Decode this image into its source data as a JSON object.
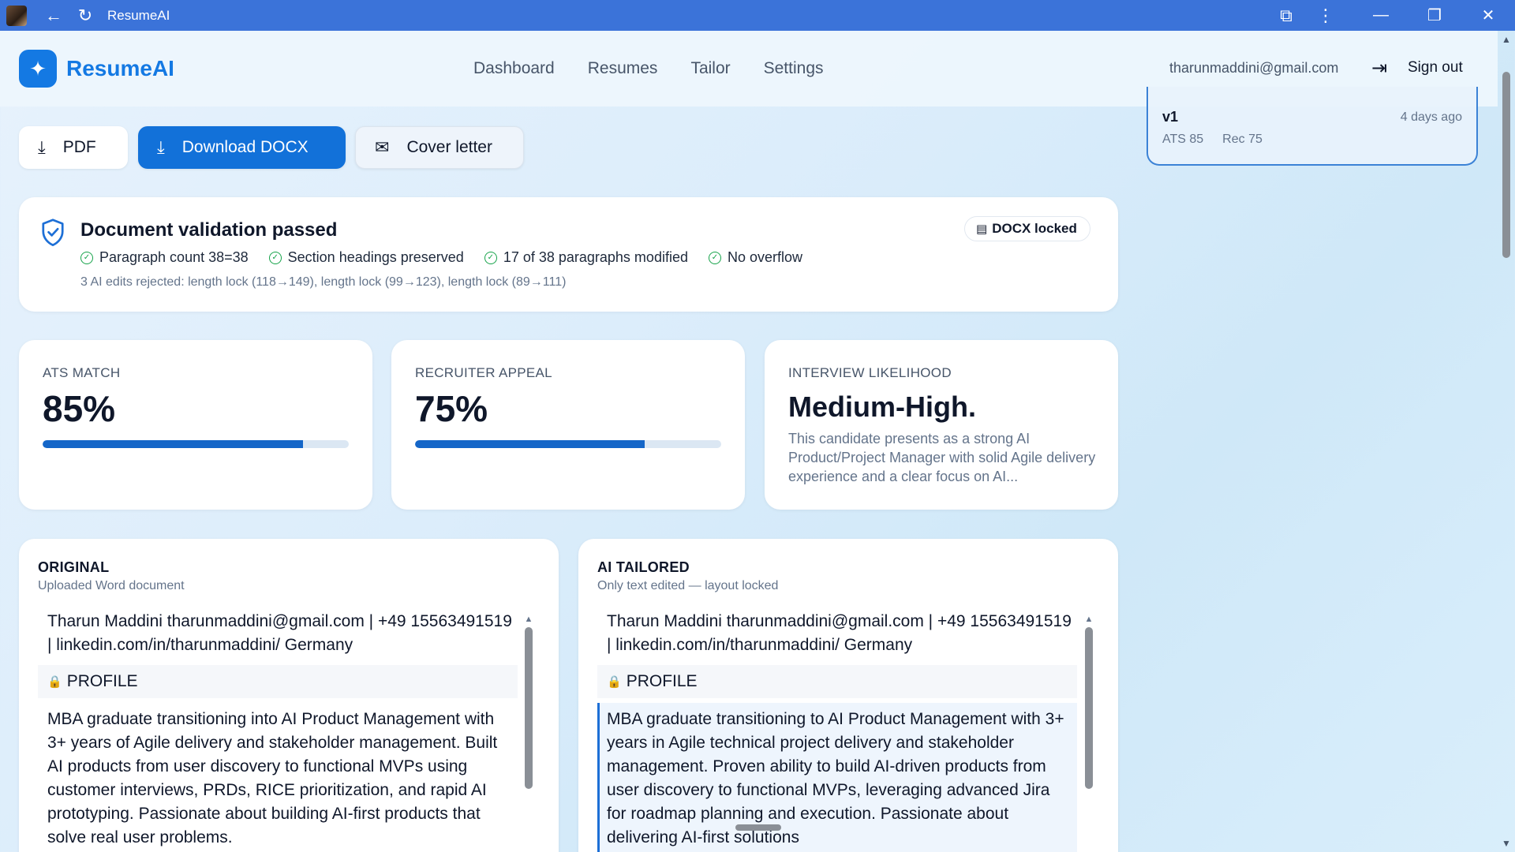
{
  "browser": {
    "tab_title": "ResumeAI",
    "back_icon": "←",
    "reload_icon": "↻",
    "extensions_icon": "⧉",
    "menu_icon": "⋮",
    "minimize_icon": "—",
    "restore_icon": "❐",
    "close_icon": "✕"
  },
  "header": {
    "logo_icon": "✦",
    "brand": "ResumeAI",
    "nav": [
      "Dashboard",
      "Resumes",
      "Tailor",
      "Settings"
    ],
    "user_email": "tharunmaddini@gmail.com",
    "signout_icon": "⇥",
    "signout_label": "Sign out"
  },
  "actions": {
    "download_icon": "⤓",
    "pdf_label": "PDF",
    "docx_label": "Download DOCX",
    "cover_icon": "✉",
    "cover_label": "Cover letter"
  },
  "validation": {
    "title": "Document validation passed",
    "checks": [
      "Paragraph count 38=38",
      "Section headings preserved",
      "17 of 38 paragraphs modified",
      "No overflow"
    ],
    "check_icon": "✓",
    "rejected_note": "3 AI edits rejected: length lock (118→149), length lock (99→123), length lock (89→111)",
    "badge_icon": "▤",
    "badge_label": "DOCX locked"
  },
  "metrics": {
    "ats": {
      "label": "ATS MATCH",
      "value": "85%",
      "progress": 0.85
    },
    "recruiter": {
      "label": "RECRUITER APPEAL",
      "value": "75%",
      "progress": 0.75
    },
    "interview": {
      "label": "INTERVIEW LIKELIHOOD",
      "value": "Medium-High.",
      "description": "This candidate presents as a strong AI Product/Project Manager with solid Agile delivery experience and a clear focus on AI..."
    }
  },
  "original": {
    "title": "ORIGINAL",
    "subtitle": "Uploaded Word document",
    "contact": "Tharun Maddini tharunmaddini@gmail.com | +49 15563491519 | linkedin.com/in/tharunmaddini/ Germany",
    "section": "PROFILE",
    "paragraph": "MBA graduate transitioning into AI Product Management with 3+ years of Agile delivery and stakeholder management. Built AI products from user discovery to functional MVPs using customer interviews, PRDs, RICE prioritization, and rapid AI prototyping. Passionate about building AI-first products that solve real user problems."
  },
  "tailored": {
    "title": "AI TAILORED",
    "subtitle": "Only text edited — layout locked",
    "contact": "Tharun Maddini tharunmaddini@gmail.com | +49 15563491519 | linkedin.com/in/tharunmaddini/ Germany",
    "section": "PROFILE",
    "paragraph": "MBA graduate transitioning to AI Product Management with 3+ years in Agile technical project delivery and stakeholder management. Proven ability to build AI-driven products from user discovery to functional MVPs, leveraging advanced Jira for roadmap planning and execution. Passionate about delivering AI-first solutions"
  },
  "version": {
    "name": "v1",
    "time": "4 days ago",
    "ats": "ATS 85",
    "rec": "Rec 75"
  },
  "colors": {
    "accent": "#1479e3",
    "primary_button": "#1271d9",
    "titlebar": "#3b73d9",
    "success": "#16a34a"
  }
}
